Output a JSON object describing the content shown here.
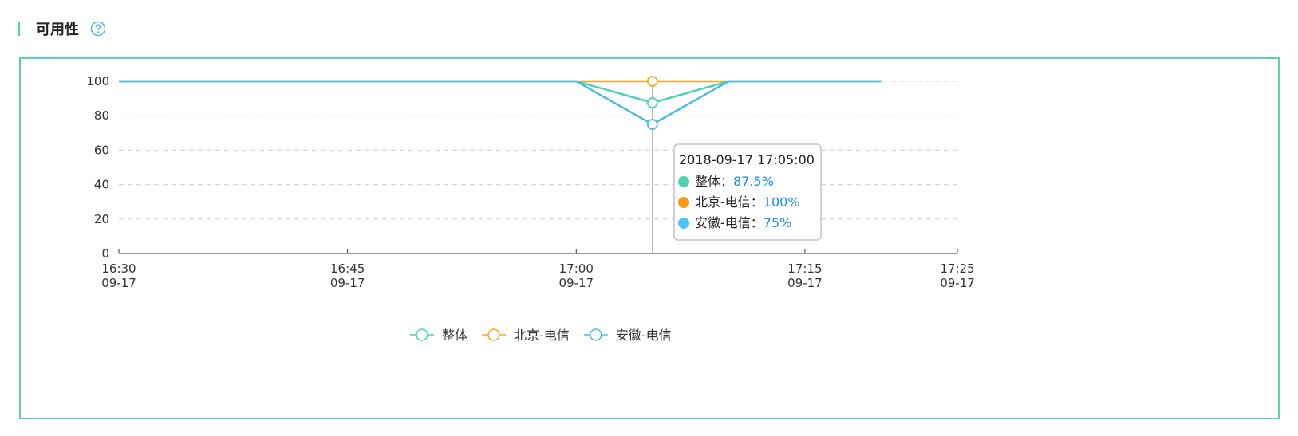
{
  "header": {
    "title": "可用性",
    "help_icon": "question-circle-icon",
    "accent_color": "#4fd1b5"
  },
  "chart_data": {
    "type": "line",
    "x_ticks": [
      {
        "time": "16:30",
        "date": "09-17",
        "minutes": 0
      },
      {
        "time": "16:45",
        "date": "09-17",
        "minutes": 15
      },
      {
        "time": "17:00",
        "date": "09-17",
        "minutes": 30
      },
      {
        "time": "17:15",
        "date": "09-17",
        "minutes": 45
      },
      {
        "time": "17:25",
        "date": "09-17",
        "minutes": 55
      }
    ],
    "y_ticks": [
      0,
      20,
      40,
      60,
      80,
      100
    ],
    "ylim": [
      0,
      100
    ],
    "x": [
      "16:30",
      "16:35",
      "16:40",
      "16:45",
      "16:50",
      "16:55",
      "17:00",
      "17:05",
      "17:10",
      "17:15",
      "17:20"
    ],
    "series": [
      {
        "name": "整体",
        "color": "#4fd1b5",
        "values": [
          100,
          100,
          100,
          100,
          100,
          100,
          100,
          87.5,
          100,
          100,
          100
        ]
      },
      {
        "name": "北京-电信",
        "color": "#f5a623",
        "values": [
          100,
          100,
          100,
          100,
          100,
          100,
          100,
          100,
          100,
          100,
          100
        ]
      },
      {
        "name": "安徽-电信",
        "color": "#4fb8e6",
        "values": [
          100,
          100,
          100,
          100,
          100,
          100,
          100,
          75,
          100,
          100,
          100
        ]
      }
    ],
    "grid": true,
    "legend_position": "bottom-center",
    "tooltip": {
      "title": "2018-09-17 17:05:00",
      "index": 7,
      "items": [
        {
          "name": "整体",
          "value": "87.5%",
          "dot_color": "#4fd1b5"
        },
        {
          "name": "北京-电信",
          "value": "100%",
          "dot_color": "#f39c12"
        },
        {
          "name": "安徽-电信",
          "value": "75%",
          "dot_color": "#4fc3f7"
        }
      ]
    }
  }
}
